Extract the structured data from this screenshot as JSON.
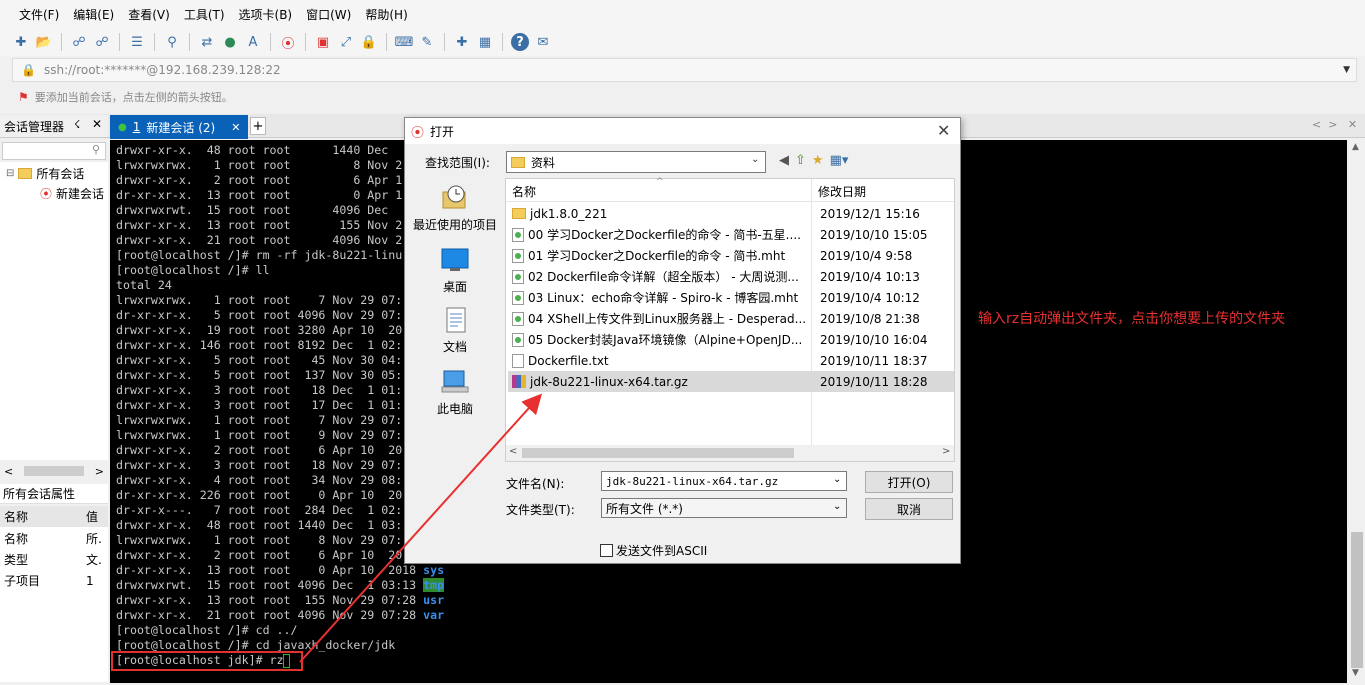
{
  "menu": [
    "文件(F)",
    "编辑(E)",
    "查看(V)",
    "工具(T)",
    "选项卡(B)",
    "窗口(W)",
    "帮助(H)"
  ],
  "toolbar_icons": [
    "new-session-icon",
    "open-folder-icon",
    "disconnect-icon",
    "reconnect-icon",
    "properties-icon",
    "search-icon",
    "transfer-icon",
    "globe-icon",
    "font-icon",
    "xftp-icon",
    "xshell-icon",
    "fullscreen-icon",
    "lock-icon",
    "keyboard-icon",
    "highlight-icon",
    "new-tab-icon",
    "layout-icon",
    "help-icon",
    "chat-icon"
  ],
  "address": "ssh://root:*******@192.168.239.128:22",
  "hint": "要添加当前会话，点击左侧的箭头按钮。",
  "session_manager": {
    "title": "会话管理器",
    "tree": {
      "root": "所有会话",
      "child": "新建会话"
    },
    "props_title": "所有会话属性",
    "props_header": {
      "key": "名称",
      "value": "值"
    },
    "props": [
      {
        "key": "名称",
        "value": "所."
      },
      {
        "key": "类型",
        "value": "文."
      },
      {
        "key": "子项目",
        "value": "1"
      }
    ]
  },
  "tab": {
    "index": "1",
    "label": "新建会话 (2)"
  },
  "terminal_lines": [
    {
      "text": "drwxr-xr-x.  48 root root      1440 Dec",
      "dir": ""
    },
    {
      "text": "lrwxrwxrwx.   1 root root         8 Nov 2",
      "dir": ""
    },
    {
      "text": "drwxr-xr-x.   2 root root         6 Apr 1",
      "dir": ""
    },
    {
      "text": "dr-xr-xr-x.  13 root root         0 Apr 1",
      "dir": ""
    },
    {
      "text": "drwxrwxrwt.  15 root root      4096 Dec",
      "dir": ""
    },
    {
      "text": "drwxr-xr-x.  13 root root       155 Nov 2",
      "dir": ""
    },
    {
      "text": "drwxr-xr-x.  21 root root      4096 Nov 2",
      "dir": ""
    },
    {
      "text": "[root@localhost /]# rm -rf jdk-8u221-linu",
      "dir": ""
    },
    {
      "text": "[root@localhost /]# ll",
      "dir": ""
    },
    {
      "text": "total 24",
      "dir": ""
    },
    {
      "text": "lrwxrwxrwx.   1 root root    7 Nov 29 07:",
      "dir": ""
    },
    {
      "text": "dr-xr-xr-x.   5 root root 4096 Nov 29 07:",
      "dir": ""
    },
    {
      "text": "drwxr-xr-x.  19 root root 3280 Apr 10  20",
      "dir": ""
    },
    {
      "text": "drwxr-xr-x. 146 root root 8192 Dec  1 02:",
      "dir": ""
    },
    {
      "text": "drwxr-xr-x.   5 root root   45 Nov 30 04:",
      "dir": ""
    },
    {
      "text": "drwxr-xr-x.   5 root root  137 Nov 30 05:",
      "dir": ""
    },
    {
      "text": "drwxr-xr-x.   3 root root   18 Dec  1 01:",
      "dir": ""
    },
    {
      "text": "drwxr-xr-x.   3 root root   17 Dec  1 01:",
      "dir": ""
    },
    {
      "text": "lrwxrwxrwx.   1 root root    7 Nov 29 07:",
      "dir": ""
    },
    {
      "text": "lrwxrwxrwx.   1 root root    9 Nov 29 07:",
      "dir": ""
    },
    {
      "text": "drwxr-xr-x.   2 root root    6 Apr 10  20",
      "dir": ""
    },
    {
      "text": "drwxr-xr-x.   3 root root   18 Nov 29 07:",
      "dir": ""
    },
    {
      "text": "drwxr-xr-x.   4 root root   34 Nov 29 08:",
      "dir": ""
    },
    {
      "text": "dr-xr-xr-x. 226 root root    0 Apr 10  20",
      "dir": ""
    },
    {
      "text": "dr-xr-x---.   7 root root  284 Dec  1 02:",
      "dir": ""
    },
    {
      "text": "drwxr-xr-x.  48 root root 1440 Dec  1 03:",
      "dir": ""
    },
    {
      "text": "lrwxrwxrwx.   1 root root    8 Nov 29 07:",
      "dir": ""
    },
    {
      "text": "drwxr-xr-x.   2 root root    6 Apr 10  20",
      "dir": ""
    },
    {
      "text": "dr-xr-xr-x.  13 root root    0 Apr 10  2018 ",
      "dir": "sys"
    },
    {
      "text": "drwxrwxrwt.  15 root root 4096 Dec  1 03:13 ",
      "dir": "tmp",
      "tmp": true
    },
    {
      "text": "drwxr-xr-x.  13 root root  155 Nov 29 07:28 ",
      "dir": "usr"
    },
    {
      "text": "drwxr-xr-x.  21 root root 4096 Nov 29 07:28 ",
      "dir": "var"
    },
    {
      "text": "[root@localhost /]# cd ../",
      "dir": ""
    },
    {
      "text": "[root@localhost /]# cd javaxh_docker/jdk",
      "dir": ""
    },
    {
      "text": "[root@localhost jdk]# rz",
      "dir": ""
    }
  ],
  "annotation": "输入rz自动弹出文件夹，点击你想要上传的文件夹",
  "dialog": {
    "title": "打开",
    "look_in_label": "查找范围(I):",
    "look_in_value": "资料",
    "places": [
      "最近使用的项目",
      "桌面",
      "文档",
      "此电脑"
    ],
    "columns": {
      "name": "名称",
      "date": "修改日期"
    },
    "files": [
      {
        "name": "jdk1.8.0_221",
        "date": "2019/12/1 15:16",
        "type": "folder"
      },
      {
        "name": "00 学习Docker之Dockerfile的命令 - 简书-五星....",
        "date": "2019/10/10 15:05",
        "type": "mht"
      },
      {
        "name": "01 学习Docker之Dockerfile的命令 - 简书.mht",
        "date": "2019/10/4 9:58",
        "type": "mht"
      },
      {
        "name": "02 Dockerfile命令详解（超全版本） - 大周说测...",
        "date": "2019/10/4 10:13",
        "type": "mht"
      },
      {
        "name": "03 Linux：echo命令详解 - Spiro-k - 博客园.mht",
        "date": "2019/10/4 10:12",
        "type": "mht"
      },
      {
        "name": "04 XShell上传文件到Linux服务器上 - Desperad...",
        "date": "2019/10/8 21:38",
        "type": "mht"
      },
      {
        "name": "05 Docker封装Java环境镜像（Alpine+OpenJD...",
        "date": "2019/10/10 16:04",
        "type": "mht"
      },
      {
        "name": "Dockerfile.txt",
        "date": "2019/10/11 18:37",
        "type": "txt"
      },
      {
        "name": "jdk-8u221-linux-x64.tar.gz",
        "date": "2019/10/11 18:28",
        "type": "gz",
        "selected": true
      }
    ],
    "filename_label": "文件名(N):",
    "filename_value": "jdk-8u221-linux-x64.tar.gz",
    "filetype_label": "文件类型(T):",
    "filetype_value": "所有文件 (*.*)",
    "open_label": "打开(O)",
    "cancel_label": "取消",
    "ascii_label": "发送文件到ASCII"
  }
}
